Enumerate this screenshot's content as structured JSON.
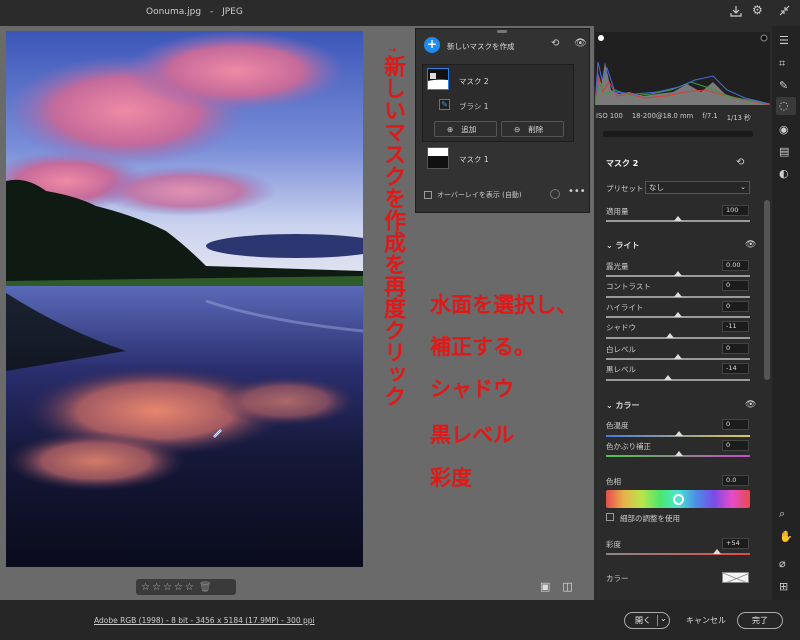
{
  "window": {
    "filename": "Oonuma.jpg",
    "separator": "-",
    "format": "JPEG"
  },
  "top_icons": [
    "download-icon",
    "gear-icon",
    "collapse-icon"
  ],
  "mask_panel": {
    "new_mask_label": "新しいマスクを作成",
    "masks": [
      {
        "name": "マスク 2",
        "selected": true,
        "components": [
          {
            "name": "ブラシ 1"
          }
        ]
      },
      {
        "name": "マスク 1",
        "selected": false
      }
    ],
    "add_label": "追加",
    "delete_label": "削除",
    "overlay_label": "オーバーレイを表示 (自動)"
  },
  "annotations": {
    "vertical": "新しいマスクを作成を再度クリック",
    "lines": [
      "水面を選択し、",
      "補正する。",
      "シャドウ",
      "黒レベル",
      "彩度"
    ],
    "color": "#e01818"
  },
  "histogram": {
    "exif": [
      "ISO 100",
      "18-200@18.0 mm",
      "f/7.1",
      "1/13 秒"
    ]
  },
  "mask_settings": {
    "title": "マスク 2",
    "preset_label": "プリセット",
    "preset_value": "なし",
    "amount_label": "適用量",
    "amount_value": "100",
    "amount_level": 0.5,
    "light": {
      "title": "ライト",
      "sliders": [
        {
          "label": "露光量",
          "value": "0.00",
          "level": 0.5
        },
        {
          "label": "コントラスト",
          "value": "0",
          "level": 0.5
        },
        {
          "label": "ハイライト",
          "value": "0",
          "level": 0.5
        },
        {
          "label": "シャドウ",
          "value": "-11",
          "level": 0.445
        },
        {
          "label": "白レベル",
          "value": "0",
          "level": 0.5
        },
        {
          "label": "黒レベル",
          "value": "-14",
          "level": 0.43
        }
      ]
    },
    "color": {
      "title": "カラー",
      "temp_label": "色温度",
      "temp_value": "0",
      "tint_label": "色かぶり補正",
      "tint_value": "0",
      "hue_label": "色相",
      "hue_value": "0.0",
      "detail_label": "細部の調整を使用",
      "saturation_label": "彩度",
      "saturation_value": "+54",
      "saturation_level": 0.77,
      "color_label": "カラー"
    }
  },
  "rating": {
    "stars": 5,
    "filled": 0
  },
  "bottom": {
    "file_info": "Adobe RGB (1998) - 8 bit - 3456 x 5184 (17.9MP) - 300 ppi",
    "open_label": "開く",
    "cancel_label": "キャンセル",
    "done_label": "完了"
  }
}
